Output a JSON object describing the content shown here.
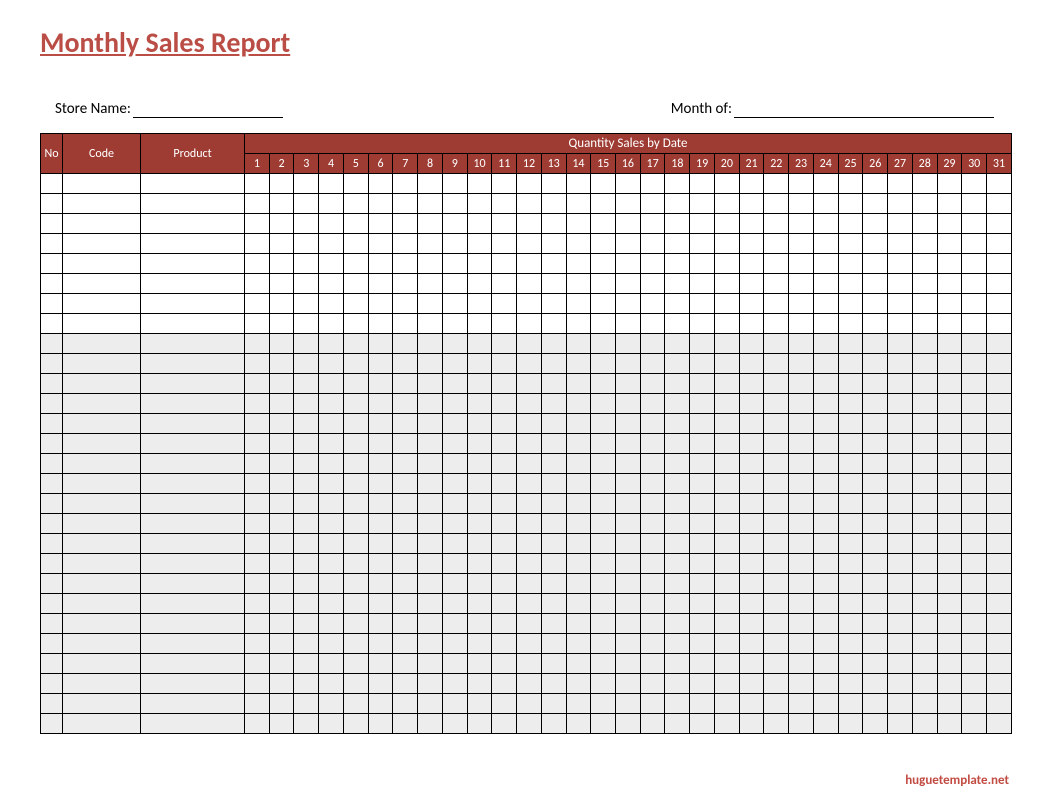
{
  "title": "Monthly Sales Report",
  "fields": {
    "store_label": "Store Name:",
    "month_label": "Month of:"
  },
  "headers": {
    "no": "No",
    "code": "Code",
    "product": "Product",
    "quantity": "Quantity Sales by Date",
    "days": [
      "1",
      "2",
      "3",
      "4",
      "5",
      "6",
      "7",
      "8",
      "9",
      "10",
      "11",
      "12",
      "13",
      "14",
      "15",
      "16",
      "17",
      "18",
      "19",
      "20",
      "21",
      "22",
      "23",
      "24",
      "25",
      "26",
      "27",
      "28",
      "29",
      "30",
      "31"
    ]
  },
  "row_count": 28,
  "white_rows": [
    1,
    2,
    3,
    4,
    5,
    6,
    7,
    8
  ],
  "footer": "huguetemplate.net"
}
